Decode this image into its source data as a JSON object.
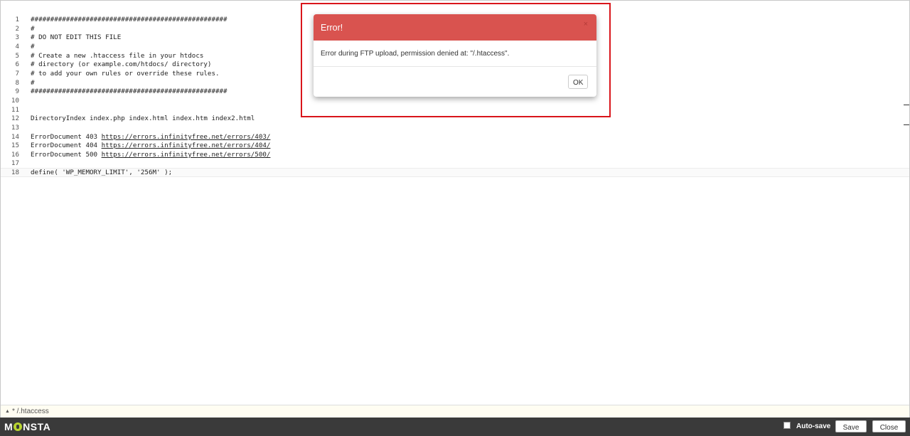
{
  "editor": {
    "lines": [
      {
        "n": "1",
        "text": "##################################################"
      },
      {
        "n": "2",
        "text": "#"
      },
      {
        "n": "3",
        "text": "# DO NOT EDIT THIS FILE"
      },
      {
        "n": "4",
        "text": "#"
      },
      {
        "n": "5",
        "text": "# Create a new .htaccess file in your htdocs"
      },
      {
        "n": "6",
        "text": "# directory (or example.com/htdocs/ directory)"
      },
      {
        "n": "7",
        "text": "# to add your own rules or override these rules."
      },
      {
        "n": "8",
        "text": "#"
      },
      {
        "n": "9",
        "text": "##################################################"
      },
      {
        "n": "10",
        "text": ""
      },
      {
        "n": "11",
        "text": ""
      },
      {
        "n": "12",
        "text": "DirectoryIndex index.php index.html index.htm index2.html"
      },
      {
        "n": "13",
        "text": ""
      },
      {
        "n": "14",
        "text": "ErrorDocument 403 ",
        "link": "https://errors.infinityfree.net/errors/403/"
      },
      {
        "n": "15",
        "text": "ErrorDocument 404 ",
        "link": "https://errors.infinityfree.net/errors/404/"
      },
      {
        "n": "16",
        "text": "ErrorDocument 500 ",
        "link": "https://errors.infinityfree.net/errors/500/"
      },
      {
        "n": "17",
        "text": ""
      },
      {
        "n": "18",
        "text": "define( 'WP_MEMORY_LIMIT', '256M' );"
      }
    ]
  },
  "statusbar": {
    "caret": "▲",
    "filename": "* /.htaccess"
  },
  "footer": {
    "logo_pre": "M",
    "logo_post": "NSTA",
    "autosave_label": "Auto-save",
    "save_label": "Save",
    "close_label": "Close"
  },
  "modal": {
    "title": "Error!",
    "close_glyph": "×",
    "message": "Error during FTP upload, permission denied at: \"/.htaccess\".",
    "ok_label": "OK"
  },
  "colors": {
    "modal_header": "#d9534f",
    "highlight": "#d9151b",
    "footer": "#3a3a3a",
    "logo_accent": "#b8d430"
  }
}
